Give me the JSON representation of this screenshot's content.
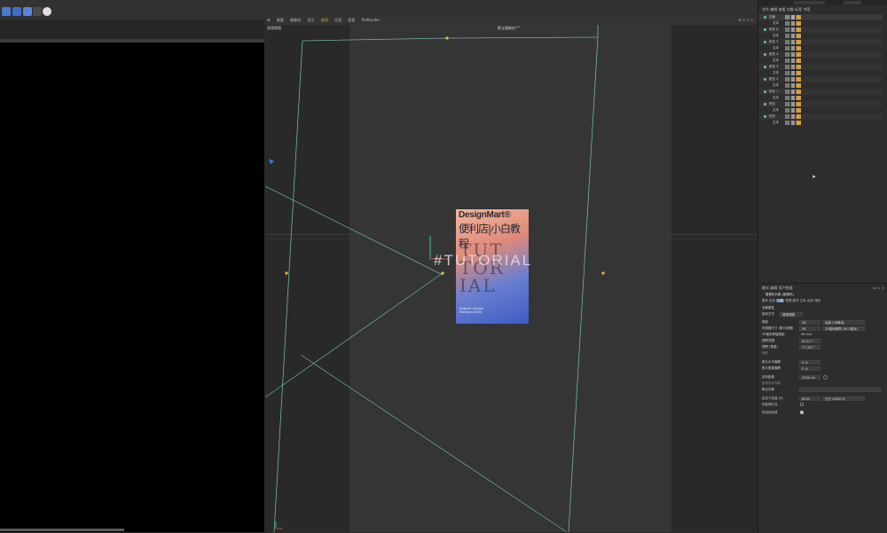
{
  "viewport": {
    "menu": [
      "查看",
      "摄像机",
      "显示",
      "选项",
      "过滤",
      "面板",
      "ProRender"
    ],
    "camera_label": "透视视图",
    "active_camera_label": "默认摄像机:*°",
    "overlay_text": "#TUTORIAL"
  },
  "poster": {
    "brand": "DesignMart®",
    "title_cn": "便利店|小白教程",
    "big_lines": [
      "TUT",
      "TOR",
      "IAL"
    ],
    "footer": "Graphic Design Bauhaus Style"
  },
  "right_panel": {
    "top_menu": [
      "文件",
      "编辑",
      "查看",
      "对象",
      "标签",
      "书签"
    ],
    "objects": [
      {
        "name": "平面"
      },
      {
        "name": "文本"
      },
      {
        "name": "挤压 6"
      },
      {
        "name": "文本"
      },
      {
        "name": "挤压 5"
      },
      {
        "name": "文本"
      },
      {
        "name": "挤压 4"
      },
      {
        "name": "文本"
      },
      {
        "name": "挤压 3"
      },
      {
        "name": "文本"
      },
      {
        "name": "挤压 2"
      },
      {
        "name": "文本"
      },
      {
        "name": "挤压 1"
      },
      {
        "name": "文本"
      },
      {
        "name": "挤压"
      },
      {
        "name": "文本"
      },
      {
        "name": "挤压"
      },
      {
        "name": "文本"
      }
    ],
    "attr_menu": [
      "模式",
      "编辑",
      "用户数据"
    ],
    "attr_object": "摄像机对象 [摄像机]",
    "attr_tabs": [
      "基本",
      "坐标",
      "对象",
      "物理",
      "细节",
      "立体",
      "合成",
      "球面"
    ],
    "section_title": "对象属性",
    "attributes": [
      {
        "label": "投射方式",
        "value": "透视视图"
      },
      {
        "label": "焦距",
        "value": "36",
        "extra": "经典 (36毫米)"
      },
      {
        "label": "传感器尺寸 (胶片规格)",
        "value": "36",
        "extra": "35毫米静物 (36.0毫米)"
      },
      {
        "label": "35毫米等值焦距:",
        "value": "36 mm"
      },
      {
        "label": "视野范围",
        "value": "53.13 °"
      },
      {
        "label": "视野 (垂直)",
        "value": "77.322 °"
      },
      {
        "label": "缩放",
        "value": ""
      },
      {
        "label": "胶片水平偏移",
        "value": "0 %"
      },
      {
        "label": "胶片垂直偏移",
        "value": "0 %"
      },
      {
        "label": "目标距离",
        "value": "2000 cm"
      },
      {
        "label": "使用目标对象",
        "value": ""
      },
      {
        "label": "焦点对象",
        "value": ""
      },
      {
        "label": "自定义色温 (K)",
        "value": "6500",
        "extra": "日光 (6500 K)"
      },
      {
        "label": "仅影响灯光",
        "value": ""
      },
      {
        "label": "导出到合成",
        "value": ""
      }
    ]
  }
}
